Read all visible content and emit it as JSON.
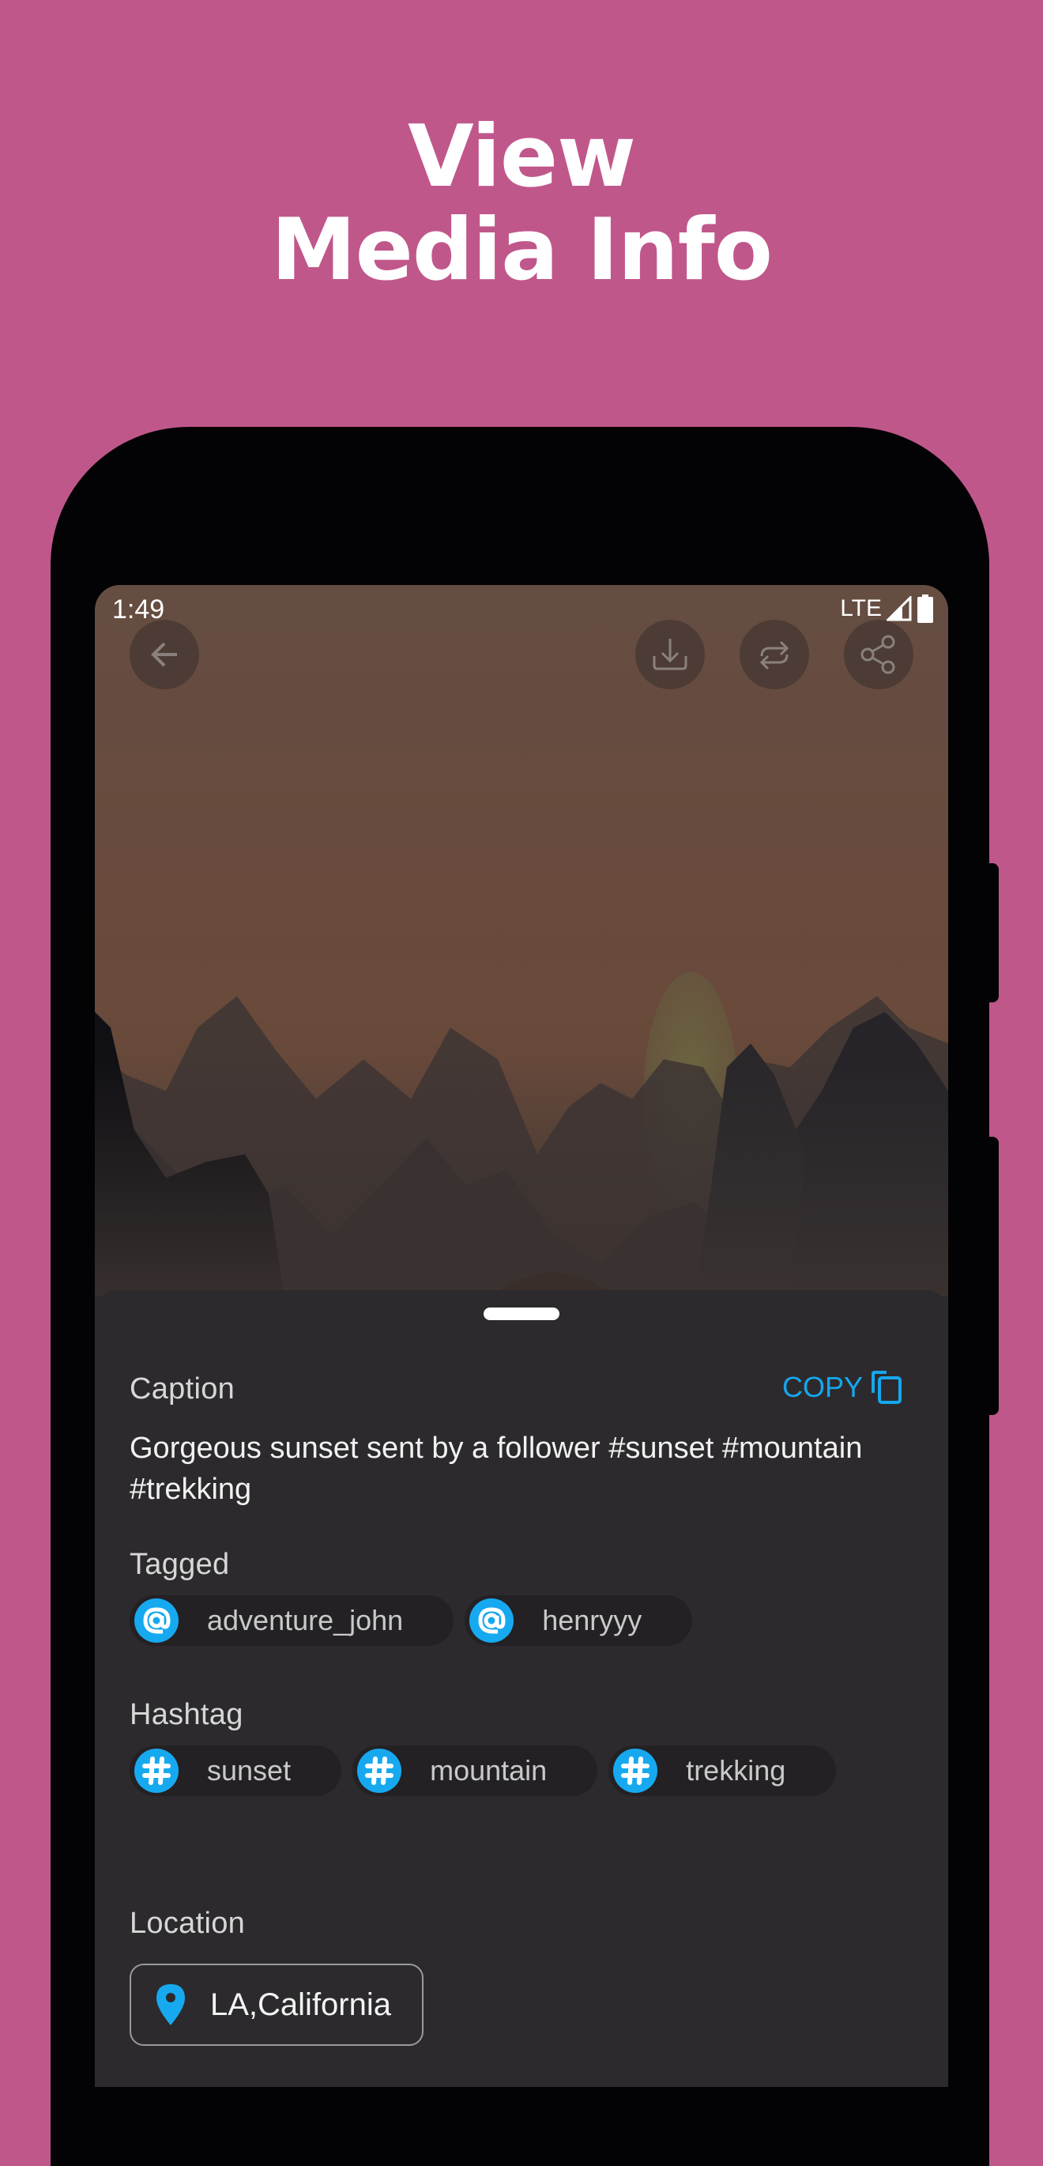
{
  "headline": {
    "line1": "View",
    "line2": "Media Info"
  },
  "status_bar": {
    "time": "1:49",
    "network": "LTE",
    "icons": [
      "signal-icon",
      "battery-icon"
    ]
  },
  "toolbar": {
    "back": {
      "icon": "arrow-left-icon"
    },
    "actions": [
      {
        "name": "download",
        "icon": "download-icon"
      },
      {
        "name": "repost",
        "icon": "repost-icon"
      },
      {
        "name": "share",
        "icon": "share-icon"
      }
    ]
  },
  "media": {
    "description": "Sunset over misty mountain range"
  },
  "sheet": {
    "caption": {
      "label": "Caption",
      "copy_label": "COPY",
      "text": "Gorgeous sunset sent by a follower #sunset #mountain #trekking"
    },
    "tagged": {
      "label": "Tagged",
      "items": [
        {
          "text": "adventure_john"
        },
        {
          "text": "henryyy"
        }
      ]
    },
    "hashtag": {
      "label": "Hashtag",
      "items": [
        {
          "text": "sunset"
        },
        {
          "text": "mountain"
        },
        {
          "text": "trekking"
        }
      ]
    },
    "location": {
      "label": "Location",
      "text": "LA,California"
    }
  },
  "colors": {
    "background": "#c0578b",
    "accent": "#17a9f0",
    "sheet": "#2c2a2d",
    "chip": "#232124"
  }
}
